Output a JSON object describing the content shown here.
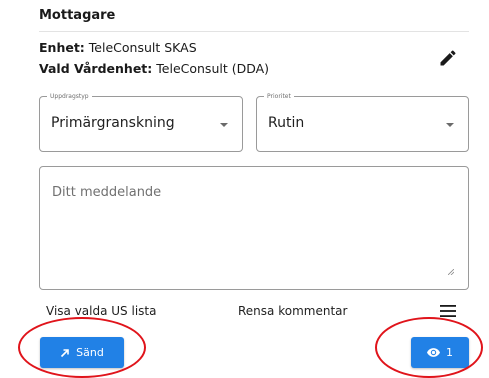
{
  "recipient": {
    "title": "Mottagare",
    "unit_label": "Enhet:",
    "unit_value": "TeleConsult SKAS",
    "care_unit_label": "Vald Vårdenhet:",
    "care_unit_value": "TeleConsult (DDA)"
  },
  "assignment_type": {
    "label": "Uppdragstyp",
    "value": "Primärgranskning"
  },
  "priority": {
    "label": "Prioritet",
    "value": "Rutin"
  },
  "message": {
    "placeholder": "Ditt meddelande",
    "value": ""
  },
  "links": {
    "show_list": "Visa valda US lista",
    "clear_comment": "Rensa kommentar"
  },
  "buttons": {
    "send_label": "Sänd",
    "view_count": "1"
  },
  "colors": {
    "primary": "#2181e6",
    "annotation": "#e0141b"
  },
  "icons": [
    "edit-icon",
    "chevron-down-icon",
    "menu-icon",
    "send-arrow-icon",
    "eye-icon"
  ]
}
